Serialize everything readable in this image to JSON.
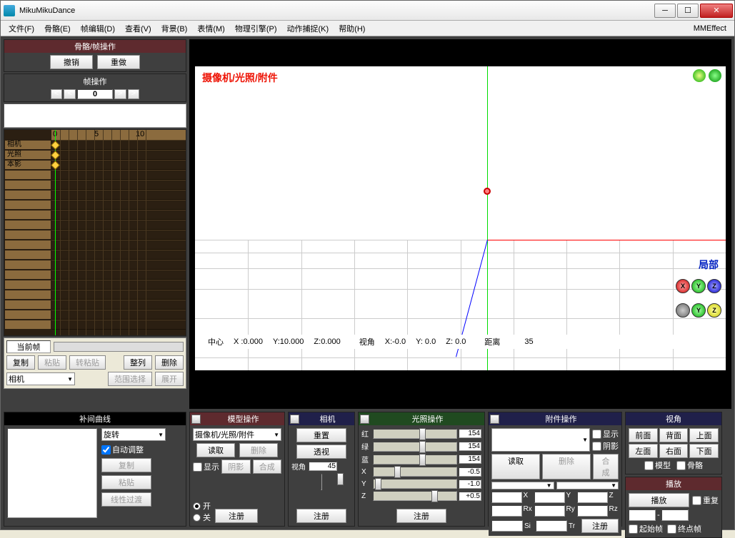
{
  "window": {
    "title": "MikuMikuDance"
  },
  "winbtns": {
    "min": "─",
    "max": "☐",
    "close": "✕"
  },
  "menu": {
    "file": "文件(F)",
    "bone": "骨骼(E)",
    "frame": "帧编辑(D)",
    "view": "查看(V)",
    "bg": "背景(B)",
    "face": "表情(M)",
    "physics": "物理引擎(P)",
    "mocap": "动作捕捉(K)",
    "help": "帮助(H)",
    "mme": "MMEffect"
  },
  "bone_frame_panel": {
    "title": "骨骼/帧操作",
    "undo": "撤销",
    "redo": "重做"
  },
  "frame_panel": {
    "title": "帧操作",
    "value": "0",
    "curframe_label": "当前帧",
    "copy": "复制",
    "paste": "粘贴",
    "rotpaste": "转粘贴",
    "align": "整列",
    "delete": "删除",
    "select_value": "相机",
    "range_sel": "范围选择",
    "expand": "展开"
  },
  "timeline": {
    "ruler": [
      "0",
      "5",
      "10"
    ],
    "tracks": [
      "相机",
      "光照",
      "本影"
    ]
  },
  "viewport": {
    "label": "摄像机/光照/附件",
    "status": {
      "center": "中心",
      "x": "X :0.000",
      "y": "Y:10.000",
      "z": "Z:0.000",
      "angle": "视角",
      "ax": "X:-0.0",
      "ay": "Y: 0.0",
      "az": "Z: 0.0",
      "dist": "距离",
      "dv": "35"
    },
    "local": "局部"
  },
  "interp": {
    "title": "补间曲线",
    "mode": "旋转",
    "auto": "自动调整",
    "copy": "复制",
    "paste": "粘贴",
    "linear": "线性过渡"
  },
  "model": {
    "title": "模型操作",
    "select_value": "摄像机/光照/附件",
    "read": "读取",
    "delete": "删除",
    "show": "显示",
    "shadow": "阴影",
    "compose": "合成",
    "on": "开",
    "off": "关",
    "register": "注册"
  },
  "camera": {
    "title": "相机",
    "reset": "重置",
    "persp": "透视",
    "angle_label": "视角",
    "angle_value": "45",
    "register": "注册"
  },
  "light": {
    "title": "光照操作",
    "r": "红",
    "g": "绿",
    "b": "蓝",
    "rv": "154",
    "gv": "154",
    "bv": "154",
    "x": "X",
    "y": "Y",
    "z": "Z",
    "xv": "-0.5",
    "yv": "-1.0",
    "zv": "+0.5",
    "register": "注册"
  },
  "acc": {
    "title": "附件操作",
    "show": "显示",
    "shadow": "阴影",
    "compose": "合成",
    "read": "读取",
    "delete": "删除",
    "x": "X",
    "y": "Y",
    "z": "Z",
    "rx": "Rx",
    "ry": "Ry",
    "rz": "Rz",
    "si": "Si",
    "tr": "Tr",
    "register": "注册"
  },
  "view": {
    "title": "视角",
    "front": "前面",
    "back": "背面",
    "top": "上面",
    "left": "左面",
    "right": "右面",
    "bottom": "下面",
    "model": "模型",
    "bone": "骨骼"
  },
  "play": {
    "title": "播放",
    "play": "播放",
    "repeat": "重复",
    "start": "起始帧",
    "end": "终点帧",
    "to": "-"
  }
}
